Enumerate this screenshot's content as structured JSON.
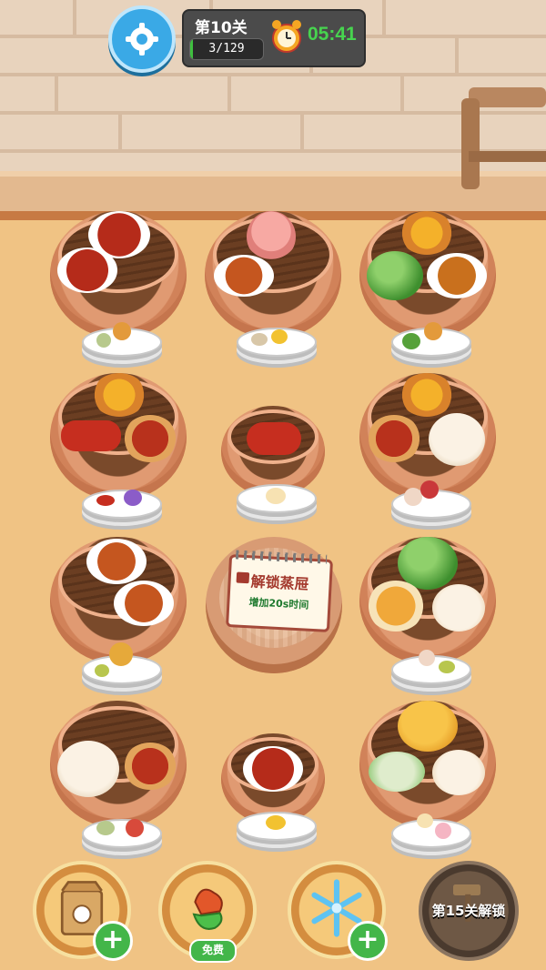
{
  "hud": {
    "level_label": "第10关",
    "progress_text": "3/129",
    "progress_fraction": 0.023,
    "timer": "05:41"
  },
  "locked_steamer": {
    "title": "解锁蒸屉",
    "subtitle": "增加20s时间"
  },
  "toolbar": {
    "tools": [
      {
        "icon": "takeout-bag-icon",
        "badge": "+"
      },
      {
        "icon": "pepper-icon",
        "badge": "免费"
      },
      {
        "icon": "snowflake-icon",
        "badge": "+"
      }
    ],
    "locked_tool_label": "第15关解锁"
  },
  "colors": {
    "timer_green": "#47d44f",
    "plus_green": "#43b649",
    "gear_blue": "#3aa9e6"
  }
}
